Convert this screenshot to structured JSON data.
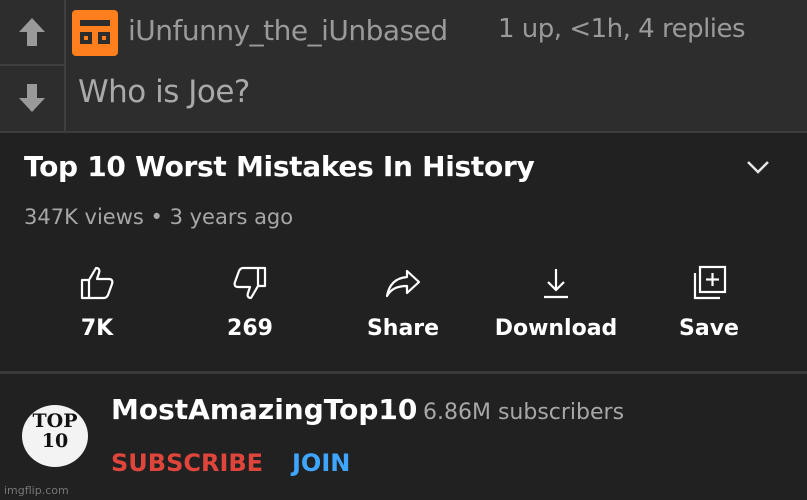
{
  "comment": {
    "username": "iUnfunny_the_iUnbased",
    "meta": "1 up, <1h, 4 replies",
    "text": "Who is Joe?",
    "upvote_icon": "arrow-up-icon",
    "downvote_icon": "arrow-down-icon",
    "avatar_color": "#ff7f1e"
  },
  "video": {
    "title": "Top 10 Worst Mistakes In History",
    "meta": "347K views • 3 years ago",
    "actions": [
      {
        "icon": "thumbs-up-icon",
        "label": "7K"
      },
      {
        "icon": "thumbs-down-icon",
        "label": "269"
      },
      {
        "icon": "share-icon",
        "label": "Share"
      },
      {
        "icon": "download-icon",
        "label": "Download"
      },
      {
        "icon": "save-playlist-icon",
        "label": "Save"
      }
    ]
  },
  "channel": {
    "logo_text": "TOP 10",
    "name": "MostAmazingTop10",
    "subscribers": "6.86M subscribers",
    "subscribe_label": "SUBSCRIBE",
    "join_label": "JOIN",
    "subscribe_color": "#e0453c",
    "join_color": "#3ea6ff"
  },
  "watermark": "imgflip.com"
}
